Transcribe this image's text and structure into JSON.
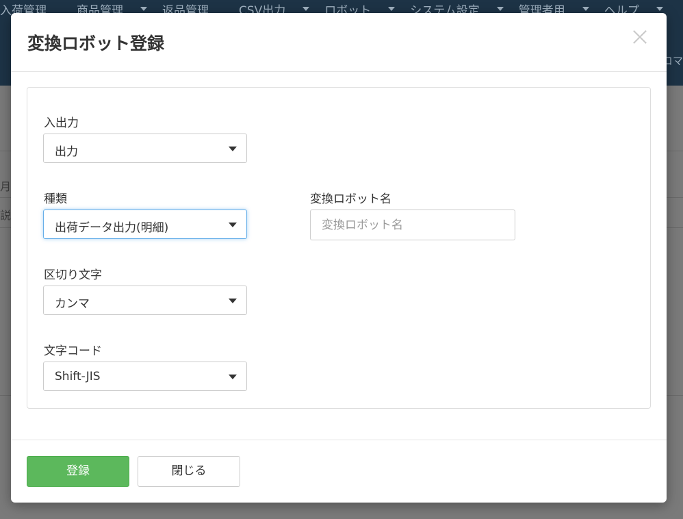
{
  "background": {
    "nav_items": [
      {
        "label": "入荷管理",
        "caret": false
      },
      {
        "label": "商品管理",
        "caret": true
      },
      {
        "label": "返品管理",
        "caret": false
      },
      {
        "label": "CSV出力",
        "caret": true
      },
      {
        "label": "ロボット",
        "caret": true
      },
      {
        "label": "システム設定",
        "caret": true
      },
      {
        "label": "管理者用",
        "caret": true
      },
      {
        "label": "ヘルプ",
        "caret": true
      }
    ],
    "nav_right_text": "コマ",
    "row_texts": [
      "月",
      "説明"
    ]
  },
  "modal": {
    "title": "変換ロボット登録",
    "fields": {
      "io": {
        "label": "入出力",
        "value": "出力"
      },
      "type": {
        "label": "種類",
        "value": "出荷データ出力(明細)"
      },
      "robot_name": {
        "label": "変換ロボット名",
        "placeholder": "変換ロボット名",
        "value": ""
      },
      "delimiter": {
        "label": "区切り文字",
        "value": "カンマ"
      },
      "encoding": {
        "label": "文字コード",
        "value": "Shift-JIS"
      }
    },
    "buttons": {
      "register": "登録",
      "close": "閉じる"
    }
  },
  "colors": {
    "primary": "#5cb85c",
    "focus": "#66afe9",
    "nav_bg": "#1d3346"
  }
}
